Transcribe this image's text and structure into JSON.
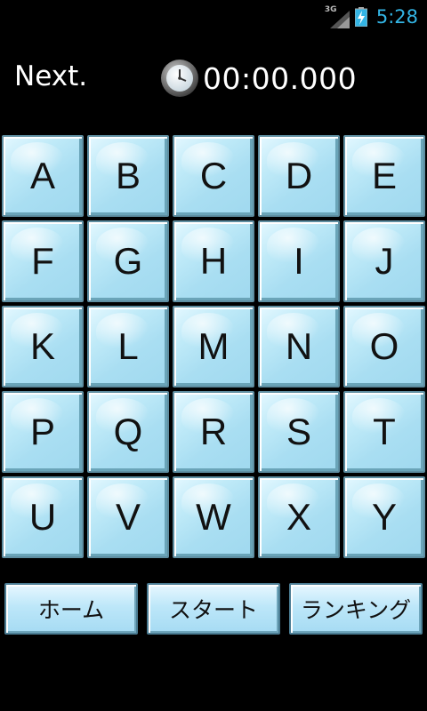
{
  "status_bar": {
    "network_type": "3G",
    "time": "5:28",
    "icons": [
      "signal-icon",
      "battery-charging-icon"
    ],
    "accent_color": "#33b5e5"
  },
  "header": {
    "next_label": "Next.",
    "timer_icon": "stopwatch-icon",
    "timer_value": "00:00.000"
  },
  "grid": {
    "tiles": [
      "A",
      "B",
      "C",
      "D",
      "E",
      "F",
      "G",
      "H",
      "I",
      "J",
      "K",
      "L",
      "M",
      "N",
      "O",
      "P",
      "Q",
      "R",
      "S",
      "T",
      "U",
      "V",
      "W",
      "X",
      "Y"
    ],
    "tile_color": "#a9def2"
  },
  "buttons": {
    "home": "ホーム",
    "start": "スタート",
    "ranking": "ランキング"
  }
}
